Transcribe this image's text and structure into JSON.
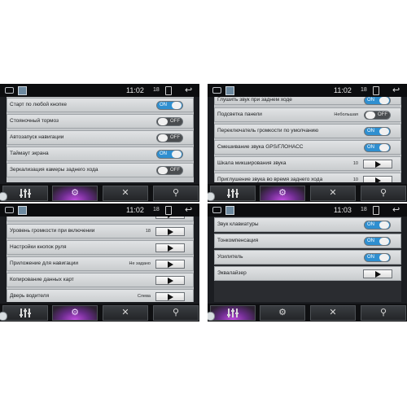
{
  "panels": [
    {
      "status": {
        "time": "11:02",
        "volume": "18"
      },
      "rows": [
        {
          "label": "Старт по любой кнопке",
          "control": "toggle",
          "state": "ON"
        },
        {
          "label": "Стояночный тормоз",
          "control": "toggle",
          "state": "OFF"
        },
        {
          "label": "Автозапуск навигации",
          "control": "toggle",
          "state": "OFF"
        },
        {
          "label": "Таймаут экрана",
          "control": "toggle",
          "state": "ON"
        },
        {
          "label": "Зеркализация камеры заднего хода",
          "control": "toggle",
          "state": "OFF"
        }
      ],
      "active_tab": 1
    },
    {
      "status": {
        "time": "11:02",
        "volume": "18"
      },
      "rows": [
        {
          "label": "Глушить звук при заднем ходе",
          "control": "toggle",
          "state": "ON"
        },
        {
          "label": "Подсветка панели",
          "control": "toggle",
          "state": "OFF",
          "value": "Небольшая"
        },
        {
          "label": "Переключатель громкости по умолчанию",
          "control": "toggle",
          "state": "ON"
        },
        {
          "label": "Смешивание звука GPS/ГЛОНАСС",
          "control": "toggle",
          "state": "ON"
        },
        {
          "label": "Шкала микширования звука",
          "control": "button",
          "value": "10"
        },
        {
          "label": "Приглушение звука во время заднего хода",
          "control": "button",
          "value": "10"
        }
      ],
      "active_tab": 1
    },
    {
      "status": {
        "time": "11:02",
        "volume": "18"
      },
      "rows": [
        {
          "label": "",
          "control": "button"
        },
        {
          "label": "Уровень громкости при включении",
          "control": "button",
          "value": "18"
        },
        {
          "label": "Настройки кнопок руля",
          "control": "button"
        },
        {
          "label": "Приложение для навигации",
          "control": "button",
          "value": "Не задано"
        },
        {
          "label": "Копирование данных карт",
          "control": "button"
        },
        {
          "label": "Дверь водителя",
          "control": "button",
          "value": "Слева"
        }
      ],
      "active_tab": 1
    },
    {
      "status": {
        "time": "11:03",
        "volume": "18"
      },
      "rows": [
        {
          "label": "Звук клавиатуры",
          "control": "toggle",
          "state": "ON"
        },
        {
          "label": "Тонкомпенсация",
          "control": "toggle",
          "state": "ON"
        },
        {
          "label": "Усилитель",
          "control": "toggle",
          "state": "ON"
        },
        {
          "label": "Эквалайзер",
          "control": "button"
        }
      ],
      "active_tab": 0
    }
  ],
  "tabs": [
    {
      "icon": "equalizer-icon"
    },
    {
      "icon": "gear-icon"
    },
    {
      "icon": "tools-icon"
    },
    {
      "icon": "car-settings-icon"
    }
  ],
  "colors": {
    "toggle_on": "#2f8fd0",
    "toggle_off": "#4a4d50",
    "active_tab": "#c04de0"
  }
}
